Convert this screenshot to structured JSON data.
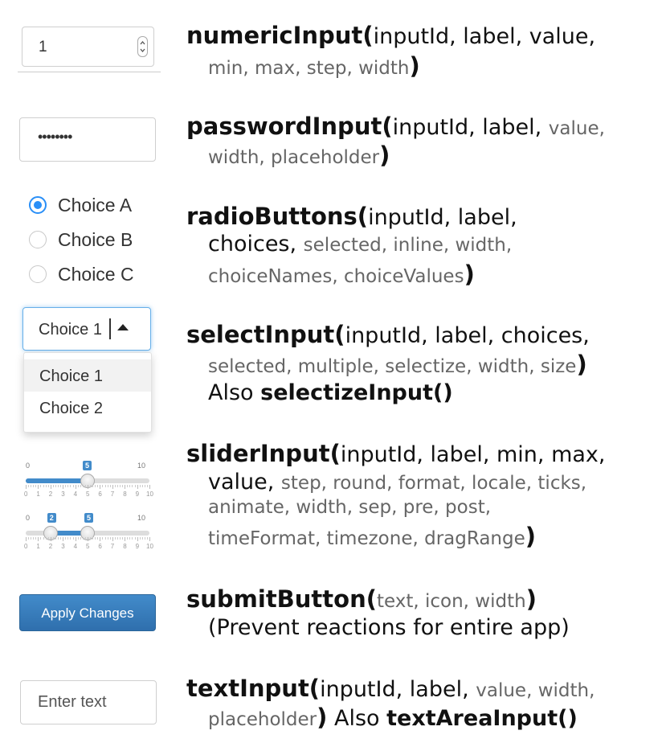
{
  "widgets": {
    "numeric": {
      "value": "1"
    },
    "password": {
      "value": "••••••••"
    },
    "radio": {
      "choices": [
        "Choice A",
        "Choice B",
        "Choice C"
      ],
      "selected_index": 0
    },
    "select": {
      "value": "Choice 1",
      "options": [
        "Choice 1",
        "Choice 2"
      ],
      "highlighted_index": 0
    },
    "slider_single": {
      "min": "0",
      "max": "10",
      "value": "5",
      "value_num": 5
    },
    "slider_range": {
      "min": "0",
      "max": "10",
      "low": "2",
      "high": "5",
      "low_num": 2,
      "high_num": 5
    },
    "slider_grid": [
      "0",
      "1",
      "2",
      "3",
      "4",
      "5",
      "6",
      "7",
      "8",
      "9",
      "10"
    ],
    "submit": {
      "label": "Apply Changes"
    },
    "text": {
      "placeholder": "Enter text"
    }
  },
  "functions": {
    "numericInput": {
      "name": "numericInput(",
      "main_args": "inputId, label, value,",
      "opt_args": "min, max, step, width",
      "close": ")"
    },
    "passwordInput": {
      "name": "passwordInput(",
      "main_args": "inputId, label, ",
      "opt_args_1": "value,",
      "opt_args_2": "width, placeholder",
      "close": ")"
    },
    "radioButtons": {
      "name": "radioButtons(",
      "main_args": "inputId, label,",
      "main_args_2": "choices, ",
      "opt_args_1": "selected, inline, width,",
      "opt_args_2": "choiceNames, choiceValues",
      "close": ")"
    },
    "selectInput": {
      "name": "selectInput(",
      "main_args": "inputId, label, choices,",
      "opt_args": "selected, multiple, selectize, width, size",
      "close": ")",
      "also_prefix": "Also ",
      "also_name": "selectizeInput()"
    },
    "sliderInput": {
      "name": "sliderInput(",
      "main_args": "inputId, label, min, max,",
      "main_args_2": "value, ",
      "opt_args_1": "step, round, format, locale, ticks,",
      "opt_args_2": "animate, width, sep, pre, post,",
      "opt_args_3": "timeFormat, timezone, dragRange",
      "close": ")"
    },
    "submitButton": {
      "name": "submitButton(",
      "opt_args": "text, icon, width",
      "close": ")",
      "note": "(Prevent reactions for entire app)"
    },
    "textInput": {
      "name": "textInput(",
      "main_args": "inputId, label, ",
      "opt_args_1": "value, width,",
      "opt_args_2": "placeholder",
      "close": ")",
      "also_prefix": " Also ",
      "also_name": "textAreaInput()"
    }
  },
  "colors": {
    "accent": "#2a8ff7",
    "slider_blue": "#428bca",
    "button_blue": "#337ab7"
  }
}
